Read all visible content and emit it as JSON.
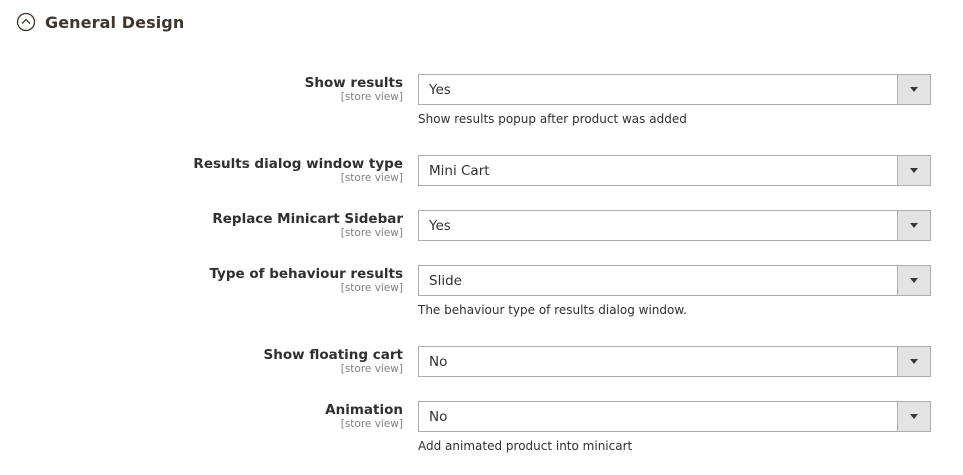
{
  "section": {
    "title": "General Design",
    "icon": "collapse-up-icon"
  },
  "fields": [
    {
      "label": "Show results",
      "scope": "[store view]",
      "value": "Yes",
      "note": "Show results popup after product was added"
    },
    {
      "label": "Results dialog window type",
      "scope": "[store view]",
      "value": "Mini Cart",
      "note": ""
    },
    {
      "label": "Replace Minicart Sidebar",
      "scope": "[store view]",
      "value": "Yes",
      "note": ""
    },
    {
      "label": "Type of behaviour results",
      "scope": "[store view]",
      "value": "Slide",
      "note": "The behaviour type of results dialog window."
    },
    {
      "label": "Show floating cart",
      "scope": "[store view]",
      "value": "No",
      "note": ""
    },
    {
      "label": "Animation",
      "scope": "[store view]",
      "value": "No",
      "note": "Add animated product into minicart"
    }
  ],
  "colors": {
    "title": "#41362f",
    "border": "#adadad",
    "arrow_bg": "#e3e3e3",
    "scope_text": "#808080"
  }
}
